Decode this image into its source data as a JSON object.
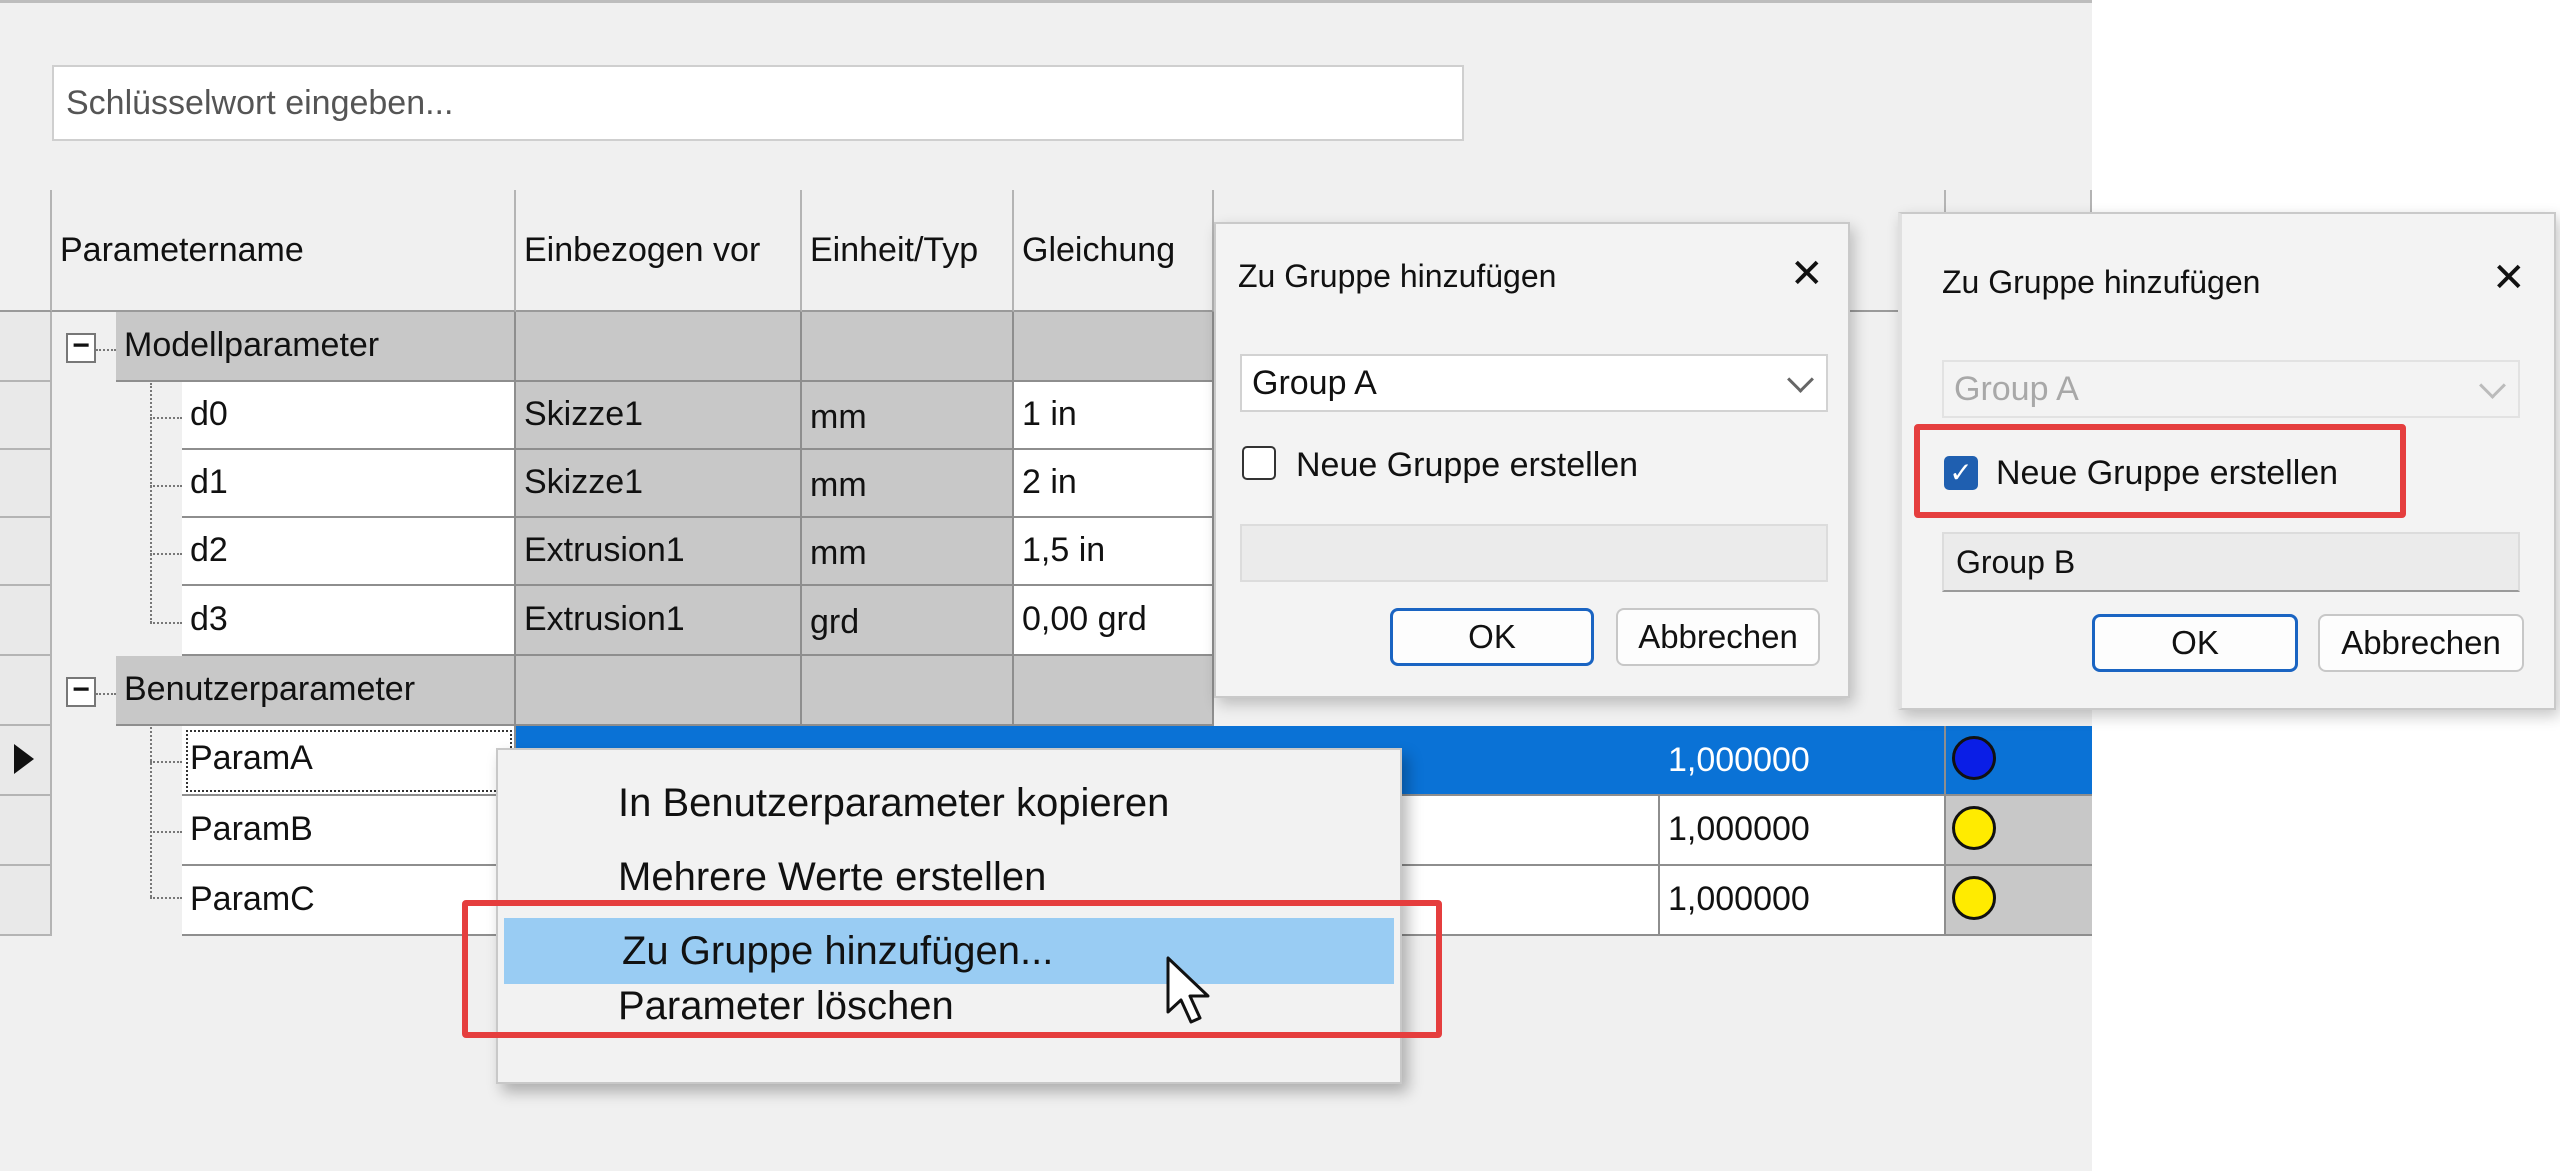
{
  "search": {
    "placeholder": "Schlüsselwort eingeben..."
  },
  "columns": {
    "name": "Parametername",
    "consumed_by": "Einbezogen vor",
    "unit": "Einheit/Typ",
    "equation": "Gleichung"
  },
  "groups": {
    "model": "Modellparameter",
    "user": "Benutzerparameter"
  },
  "model_rows": [
    {
      "name": "d0",
      "consumed_by": "Skizze1",
      "unit": "mm",
      "equation": "1 in"
    },
    {
      "name": "d1",
      "consumed_by": "Skizze1",
      "unit": "mm",
      "equation": "2 in"
    },
    {
      "name": "d2",
      "consumed_by": "Extrusion1",
      "unit": "mm",
      "equation": "1,5 in"
    },
    {
      "name": "d3",
      "consumed_by": "Extrusion1",
      "unit": "grd",
      "equation": "0,00 grd"
    }
  ],
  "user_rows": [
    {
      "name": "ParamA",
      "value": "1,000000",
      "status_color": "#0a1ee6"
    },
    {
      "name": "ParamB",
      "value": "1,000000",
      "status_color": "#ffeb00"
    },
    {
      "name": "ParamC",
      "value": "1,000000",
      "status_color": "#ffeb00"
    }
  ],
  "context_menu": {
    "items": [
      "In Benutzerparameter kopieren",
      "Mehrere Werte erstellen",
      "Zu Gruppe hinzufügen...",
      "Parameter löschen"
    ],
    "highlighted_index": 2
  },
  "dialog1": {
    "title": "Zu Gruppe hinzufügen",
    "group_select": "Group A",
    "new_group_label": "Neue Gruppe erstellen",
    "new_group_checked": false,
    "new_group_name": "",
    "ok": "OK",
    "cancel": "Abbrechen"
  },
  "dialog2": {
    "title": "Zu Gruppe hinzufügen",
    "group_select": "Group A",
    "new_group_label": "Neue Gruppe erstellen",
    "new_group_checked": true,
    "new_group_name": "Group B",
    "ok": "OK",
    "cancel": "Abbrechen"
  },
  "colors": {
    "selection": "#0a72d6",
    "highlight_box": "#e53e3e",
    "menu_hover": "#99ccf3"
  }
}
